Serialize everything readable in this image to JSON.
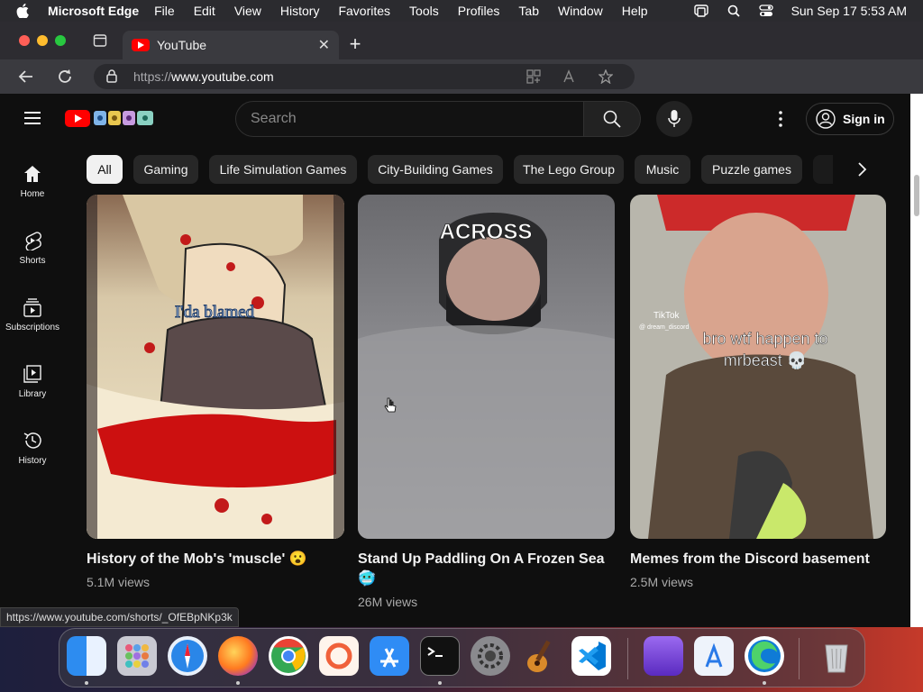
{
  "menubar": {
    "app_name": "Microsoft Edge",
    "items": [
      "File",
      "Edit",
      "View",
      "History",
      "Favorites",
      "Tools",
      "Profiles",
      "Tab",
      "Window",
      "Help"
    ],
    "clock": "Sun Sep 17  5:53 AM"
  },
  "browser": {
    "tab_title": "YouTube",
    "url_protocol": "https://",
    "url_host": "www.youtube.com"
  },
  "youtube": {
    "search_placeholder": "Search",
    "signin_label": "Sign in",
    "sidebar": [
      {
        "label": "Home",
        "icon": "home-icon"
      },
      {
        "label": "Shorts",
        "icon": "shorts-icon"
      },
      {
        "label": "Subscriptions",
        "icon": "subscriptions-icon"
      },
      {
        "label": "Library",
        "icon": "library-icon"
      },
      {
        "label": "History",
        "icon": "history-icon"
      }
    ],
    "chips": [
      "All",
      "Gaming",
      "Life Simulation Games",
      "City-Building Games",
      "The Lego Group",
      "Music",
      "Puzzle games"
    ],
    "shorts": [
      {
        "title": "History of the Mob's 'muscle' 😮",
        "views": "5.1M views",
        "caption": "I'da blamed"
      },
      {
        "title_line1": "Stand Up Paddling On A Frozen Sea",
        "title_line2": "🥶",
        "views": "26M views",
        "caption": "ACROSS"
      },
      {
        "title": "Memes from the Discord basement",
        "views": "2.5M views",
        "caption_line1": "bro wtf happen to",
        "caption_line2": "mrbeast 💀",
        "watermark": "TikTok",
        "watermark_user": "@ dream_discord"
      }
    ]
  },
  "status_url": "https://www.youtube.com/shorts/_OfEBpNKp3k",
  "dock": [
    "Finder",
    "Launchpad",
    "Safari",
    "Firefox",
    "Chrome",
    "Nova",
    "App Store",
    "Terminal",
    "System Settings",
    "GarageBand",
    "VS Code",
    "Apple Configurator",
    "Xcode Tools",
    "Edge",
    "Trash"
  ],
  "colors": {
    "youtube_red": "#ff0000",
    "edge_blue": "#1b79d6"
  }
}
